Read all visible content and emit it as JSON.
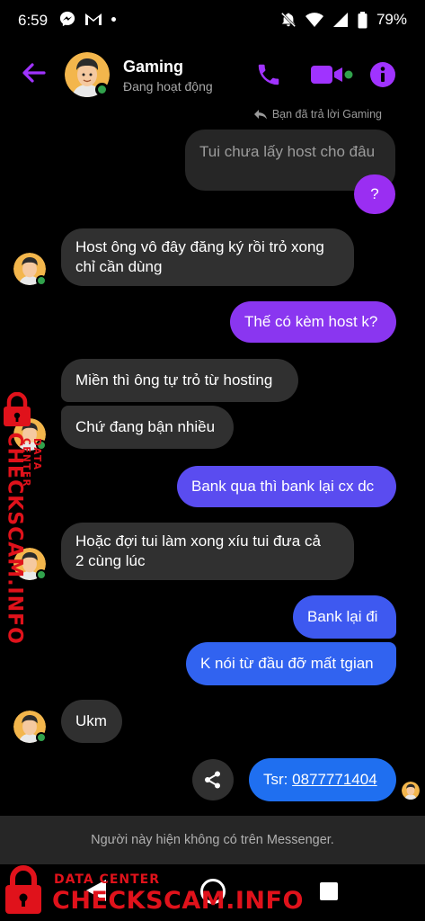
{
  "status_bar": {
    "time": "6:59",
    "battery": "79%"
  },
  "header": {
    "contact_name": "Gaming",
    "contact_status": "Đang hoạt động",
    "accent_color": "#a033ff"
  },
  "chat": {
    "replied_note": "Bạn đã trả lời Gaming",
    "messages": [
      {
        "from": "me",
        "type": "quoted",
        "text": "Tui chưa lấy host cho đâu"
      },
      {
        "from": "me",
        "text": "?"
      },
      {
        "from": "them",
        "text_lines": [
          "Host ông vô đây đăng ký rồi trỏ xong",
          "chỉ cần dùng"
        ]
      },
      {
        "from": "me",
        "text": "Thế có kèm host k?"
      },
      {
        "from": "them",
        "text": "Miền thì ông tự trỏ từ hosting"
      },
      {
        "from": "them",
        "text": "Chứ đang bận nhiều"
      },
      {
        "from": "me",
        "text": "Bank qua thì bank lại cx dc"
      },
      {
        "from": "them",
        "text_lines": [
          "Hoặc đợi tui làm xong xíu tui đưa cả",
          "2 cùng lúc"
        ]
      },
      {
        "from": "me",
        "text": "Bank lại đi"
      },
      {
        "from": "me",
        "text": "K nói từ đầu đỡ mất tgian"
      },
      {
        "from": "them",
        "text": "Ukm"
      },
      {
        "from": "me",
        "text_prefix": "Tsr: ",
        "link": "0877771404"
      }
    ]
  },
  "banner": {
    "text": "Người này hiện không có trên Messenger."
  },
  "watermark": {
    "line1": "DATA CENTER",
    "line2": "CHECKSCAM.INFO",
    "color": "#e0121b"
  }
}
